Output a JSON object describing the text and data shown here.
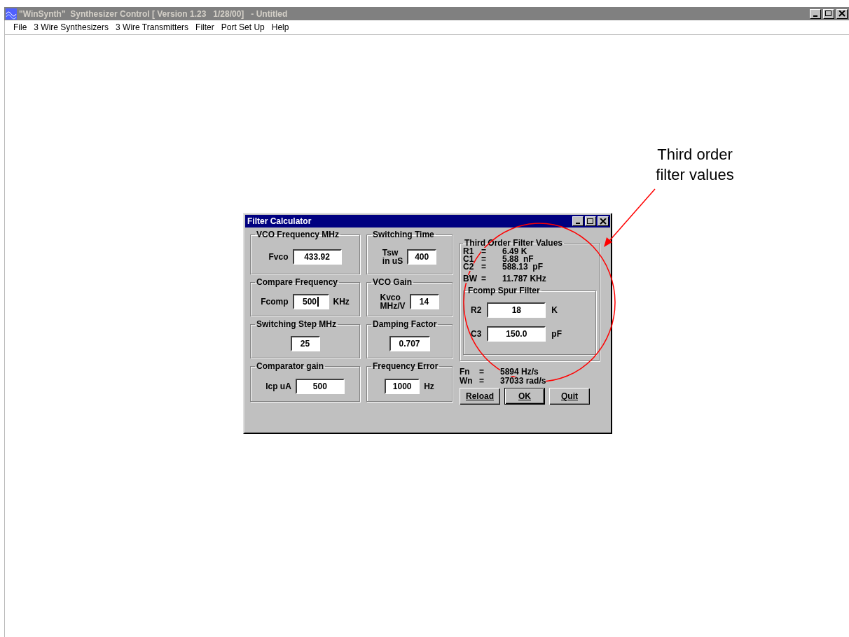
{
  "window": {
    "title": "\"WinSynth\"  Synthesizer Control [ Version 1.23   1/28/00]   - Untitled"
  },
  "menu": [
    "File",
    "3 Wire Synthesizers",
    "3 Wire Transmitters",
    "Filter",
    "Port Set Up",
    "Help"
  ],
  "dialog": {
    "title": "Filter Calculator",
    "groups": [
      {
        "title": "VCO Frequency MHz",
        "label": "Fvco",
        "value": "433.92",
        "focused": false
      },
      {
        "title": "Switching Time",
        "label": "Tsw\nin uS",
        "value": "400",
        "focused": false
      },
      {
        "title": "Compare Frequency",
        "label": "Fcomp",
        "value": "500",
        "unit": "KHz",
        "focused": true
      },
      {
        "title": "VCO Gain",
        "label": "Kvco\nMHz/V",
        "value": "14",
        "focused": false
      },
      {
        "title": "Switching Step MHz",
        "value": "25",
        "focused": false
      },
      {
        "title": "Damping Factor",
        "value": "0.707",
        "focused": false
      },
      {
        "title": "Comparator gain",
        "label": "Icp uA",
        "value": "500",
        "focused": false
      },
      {
        "title": "Frequency Error",
        "value": "1000",
        "unit": "Hz",
        "focused": false
      }
    ],
    "third_order": {
      "title": "Third Order Filter Values",
      "rows": [
        {
          "name": "R1",
          "eq": "=",
          "value": "6.49 K"
        },
        {
          "name": "C1",
          "eq": "=",
          "value": "5.88  nF"
        },
        {
          "name": "C2",
          "eq": "=",
          "value": "588.13  pF"
        },
        {
          "name": "BW",
          "eq": "=",
          "value": "11.787 KHz"
        }
      ],
      "spur": {
        "title": "Fcomp Spur Filter",
        "fields": [
          {
            "label": "R2",
            "value": "18",
            "unit": "K"
          },
          {
            "label": "C3",
            "value": "150.0",
            "unit": "pF"
          }
        ]
      }
    },
    "results": [
      {
        "name": "Fn",
        "eq": "=",
        "value": "5894 Hz/s"
      },
      {
        "name": "Wn",
        "eq": "=",
        "value": "37033 rad/s"
      }
    ],
    "buttons": [
      {
        "label": "Reload",
        "default": false
      },
      {
        "label": "OK",
        "default": true
      },
      {
        "label": "Quit",
        "default": false
      }
    ]
  },
  "annotation": {
    "text": "Third order\nfilter values"
  }
}
